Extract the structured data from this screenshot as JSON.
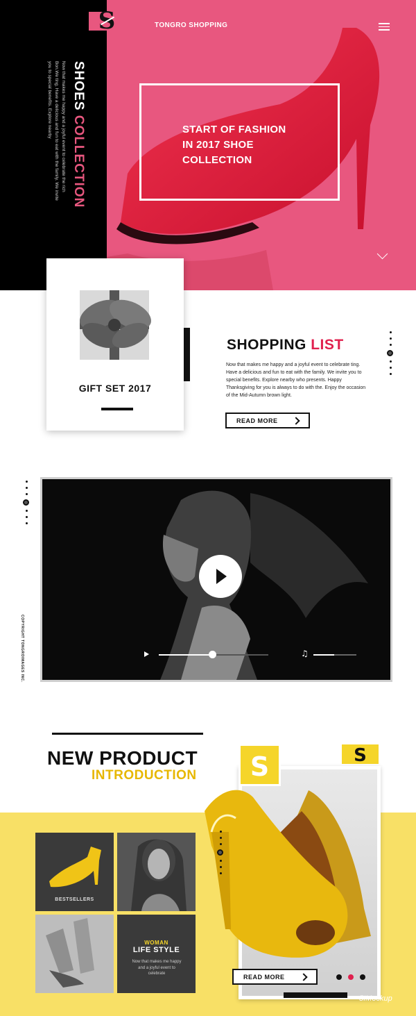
{
  "brand": {
    "logo_letter": "S",
    "name": "TONGRO SHOPPING"
  },
  "hero": {
    "vertical_title_white": "SHOES ",
    "vertical_title_pink": "COLLECTION",
    "vertical_desc": "Now that makes me happy and a joyful event to celebrate the rich Bon.We ting. Have a delicious and fun to eat with the family. We invite you to special benefits. Explore nearby",
    "headline_line1": "START OF FASHION",
    "headline_line2": "IN 2017 SHOE",
    "headline_line3": "COLLECTION"
  },
  "gift": {
    "title": "GIFT SET 2017"
  },
  "shopping": {
    "title_black": "SHOPPING ",
    "title_pink": "LIST",
    "description": "Now that makes me happy and a joyful event to celebrate ting. Have a delicious and fun to eat with the family. We invite you to special benefits. Explore nearby who presents. Happy Thanksgiving for you is always to do with the. Enjoy the occasion of the Mid-Autumn brown light.",
    "read_more": "READ MORE"
  },
  "video": {
    "progress": 0.49,
    "volume": 0.48,
    "music_glyph": "♫"
  },
  "copyright": "COPYRIGHT TONGROIMAGES INC.",
  "product": {
    "title": "NEW PRODUCT",
    "subtitle": "INTRODUCTION",
    "badge_letter": "S",
    "tiles": {
      "bestsellers": "BESTSELLERS",
      "woman": "WOMAN",
      "lifestyle": "LIFE STYLE",
      "desc": "Now that makes me happy and a joyful event to celebrate"
    },
    "read_more": "READ MORE"
  },
  "watermark": "5IMockup",
  "colors": {
    "pink": "#e8577f",
    "accent_red": "#e0204e",
    "yellow": "#f8e066",
    "gold": "#f5d52a"
  }
}
